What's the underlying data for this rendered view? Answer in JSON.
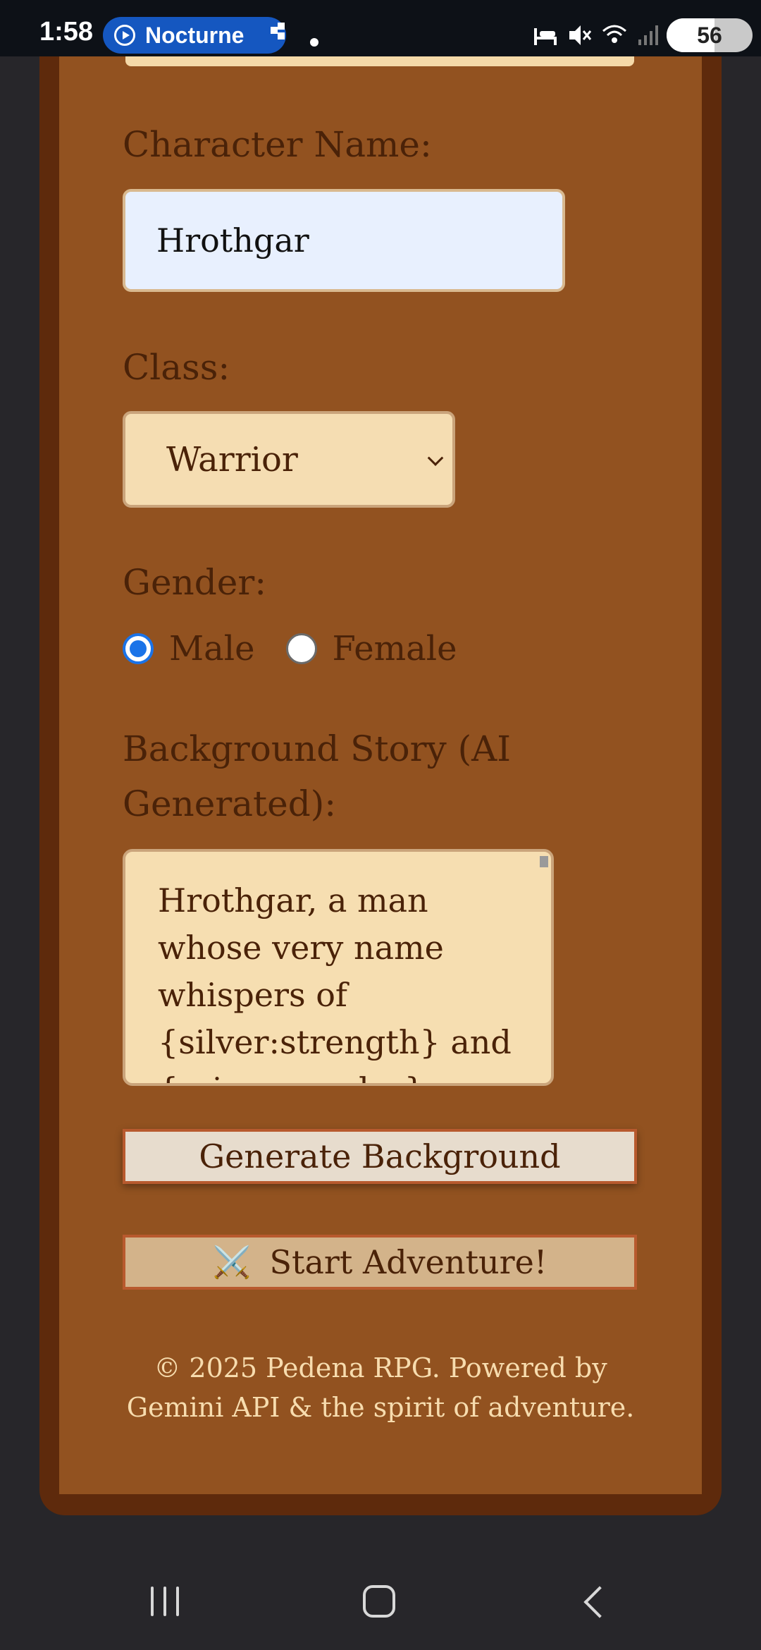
{
  "status_bar": {
    "time": "1:58",
    "app_pill": "Nocturne",
    "battery_level": "56"
  },
  "form": {
    "name_label": "Character Name:",
    "name_value": "Hrothgar",
    "class_label": "Class:",
    "class_value": "Warrior",
    "gender_label": "Gender:",
    "gender_options": [
      {
        "label": "Male",
        "checked": true
      },
      {
        "label": "Female",
        "checked": false
      }
    ],
    "story_label": "Background Story (AI Generated):",
    "story_text": "Hrothgar, a man whose very name whispers of {silver:strength} and {crimson:valor}, was born into the harsh"
  },
  "buttons": {
    "generate": "Generate Background",
    "start_icon": "⚔️",
    "start": "Start Adventure!"
  },
  "footer": {
    "line1": "© 2025 Pedena RPG. Powered by",
    "line2": "Gemini API & the spirit of adventure."
  },
  "colors": {
    "card_bg": "#925220",
    "card_border": "#5e2a0c",
    "text": "#4a2208",
    "footer_text": "#f7dcae",
    "radio_accent": "#1a73e8"
  }
}
